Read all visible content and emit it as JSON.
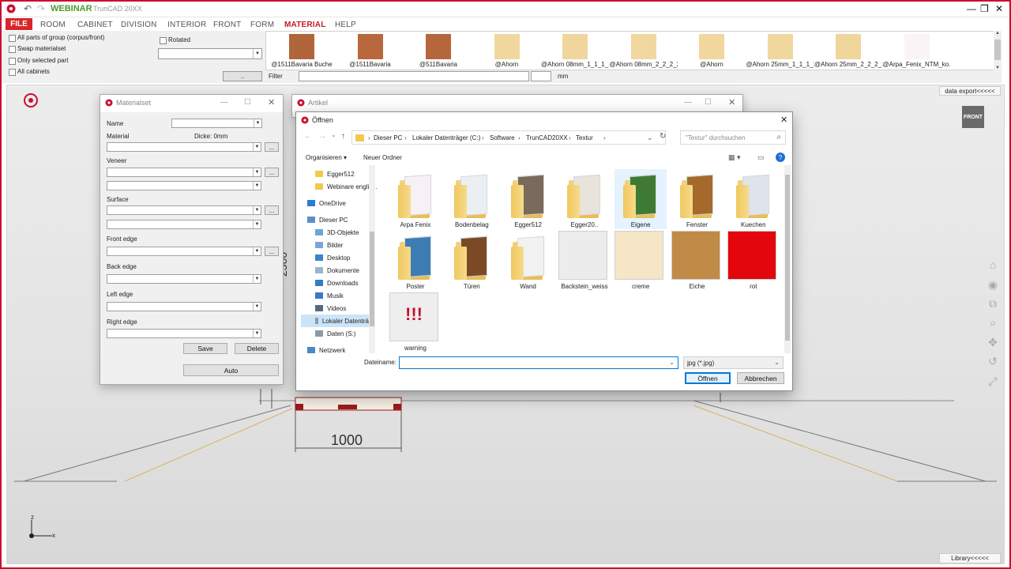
{
  "app": {
    "logo_label": "WEBINAR",
    "product": "TrunCAD 20XX",
    "accent": "#c8102e"
  },
  "menu": {
    "items": [
      "FILE",
      "ROOM",
      "CABINET",
      "DIVISION",
      "INTERIOR",
      "FRONT",
      "FORM",
      "MATERIAL",
      "HELP"
    ],
    "active": "MATERIAL"
  },
  "options": {
    "checkboxes": [
      "All parts of group (corpus/front)",
      "Swap materialset",
      "Only selected part",
      "All cabinets"
    ],
    "rotated": "Rotated",
    "button": "..",
    "filter_label": "Filter",
    "unit": "mm"
  },
  "textures": [
    {
      "label": "@1511Bavaria Buche",
      "color": "#b0653a"
    },
    {
      "label": "@1511Bavaria",
      "color": "#b8683c"
    },
    {
      "label": "@511Bavaria",
      "color": "#b5673b"
    },
    {
      "label": "@Ahorn",
      "color": "#f1d79e"
    },
    {
      "label": "@Ahorn 08mm_1_1_1_1",
      "color": "#f0d69c"
    },
    {
      "label": "@Ahorn 08mm_2_2_2_2",
      "color": "#f2d8a0"
    },
    {
      "label": "@Ahorn",
      "color": "#f1d69d"
    },
    {
      "label": "@Ahorn 25mm_1_1_1_1",
      "color": "#f0d79e"
    },
    {
      "label": "@Ahorn 25mm_2_2_2_2",
      "color": "#f1d69c"
    },
    {
      "label": "@Arpa_Fenix_NTM_ko...",
      "color": "#fbf4f7"
    }
  ],
  "workspace": {
    "data_export": "data export<<<<<",
    "library": "Library<<<<<",
    "front_cube": "FRONT",
    "dim_1000": "1000",
    "dim_2500": "2500",
    "axis_z": "z",
    "axis_x": "x"
  },
  "materialset": {
    "title": "Materialset",
    "name_label": "Name",
    "material_label": "Material",
    "thickness": "Dicke: 0mm",
    "veneer_label": "Veneer",
    "surface_label": "Surface",
    "front_edge_label": "Front edge",
    "back_edge_label": "Back edge",
    "left_edge_label": "Left edge",
    "right_edge_label": "Right edge",
    "save": "Save",
    "delete": "Delete",
    "auto": "Auto",
    "dots": "..."
  },
  "artikel": {
    "title": "Artikel"
  },
  "open_dialog": {
    "title": "Öffnen",
    "breadcrumb": [
      "Dieser PC",
      "Lokaler Datenträger (C:)",
      "Software",
      "TrunCAD20XX",
      "Textur"
    ],
    "search_placeholder": "\"Textur\" durchsuchen",
    "organize": "Organisieren ▾",
    "new_folder": "Neuer Ordner",
    "nav": [
      {
        "label": "Egger512",
        "icon": "folder-icon"
      },
      {
        "label": "Webinare englis...",
        "icon": "folder-icon"
      },
      {
        "label": "OneDrive",
        "icon": "cloud-icon"
      },
      {
        "label": "Dieser PC",
        "icon": "computer-icon"
      },
      {
        "label": "3D-Objekte",
        "icon": "cube-icon"
      },
      {
        "label": "Bilder",
        "icon": "pictures-icon"
      },
      {
        "label": "Desktop",
        "icon": "desktop-icon"
      },
      {
        "label": "Dokumente",
        "icon": "documents-icon"
      },
      {
        "label": "Downloads",
        "icon": "download-icon"
      },
      {
        "label": "Musik",
        "icon": "music-icon"
      },
      {
        "label": "Videos",
        "icon": "video-icon"
      },
      {
        "label": "Lokaler Datenträ",
        "icon": "drive-icon"
      },
      {
        "label": "Daten (S:)",
        "icon": "drive-icon"
      },
      {
        "label": "Netzwerk",
        "icon": "network-icon"
      }
    ],
    "items": [
      {
        "label": "Arpa Fenix",
        "kind": "folder",
        "color": "#f7f0f5"
      },
      {
        "label": "Bodenbelag",
        "kind": "folder",
        "color": "#eceff2"
      },
      {
        "label": "Egger512",
        "kind": "folder",
        "color": "#7a6a5c"
      },
      {
        "label": "Egger20..",
        "kind": "folder",
        "color": "#e8e3db"
      },
      {
        "label": "Eigene",
        "kind": "folder",
        "color": "#3f7a34"
      },
      {
        "label": "Fenster",
        "kind": "folder",
        "color": "#a56a2b"
      },
      {
        "label": "Kuechen",
        "kind": "folder",
        "color": "#dfe4ea"
      },
      {
        "label": "Poster",
        "kind": "folder",
        "color": "#3d7db3"
      },
      {
        "label": "Türen",
        "kind": "folder",
        "color": "#7b4a24"
      },
      {
        "label": "Wand",
        "kind": "folder",
        "color": "#f2f2f2"
      },
      {
        "label": "Backstein_weiss",
        "kind": "image",
        "color": "#ececec"
      },
      {
        "label": "creme",
        "kind": "image",
        "color": "#f5e6c8"
      },
      {
        "label": "Eiche",
        "kind": "image",
        "color": "#c18a46"
      },
      {
        "label": "rot",
        "kind": "image",
        "color": "#e3060c"
      },
      {
        "label": "warning",
        "kind": "image",
        "color": "#eeeeee"
      }
    ],
    "filename_label": "Dateiname:",
    "filename_value": "",
    "filetype": "jpg (*.jpg)",
    "open_btn": "Öffnen",
    "cancel_btn": "Abbrechen"
  }
}
